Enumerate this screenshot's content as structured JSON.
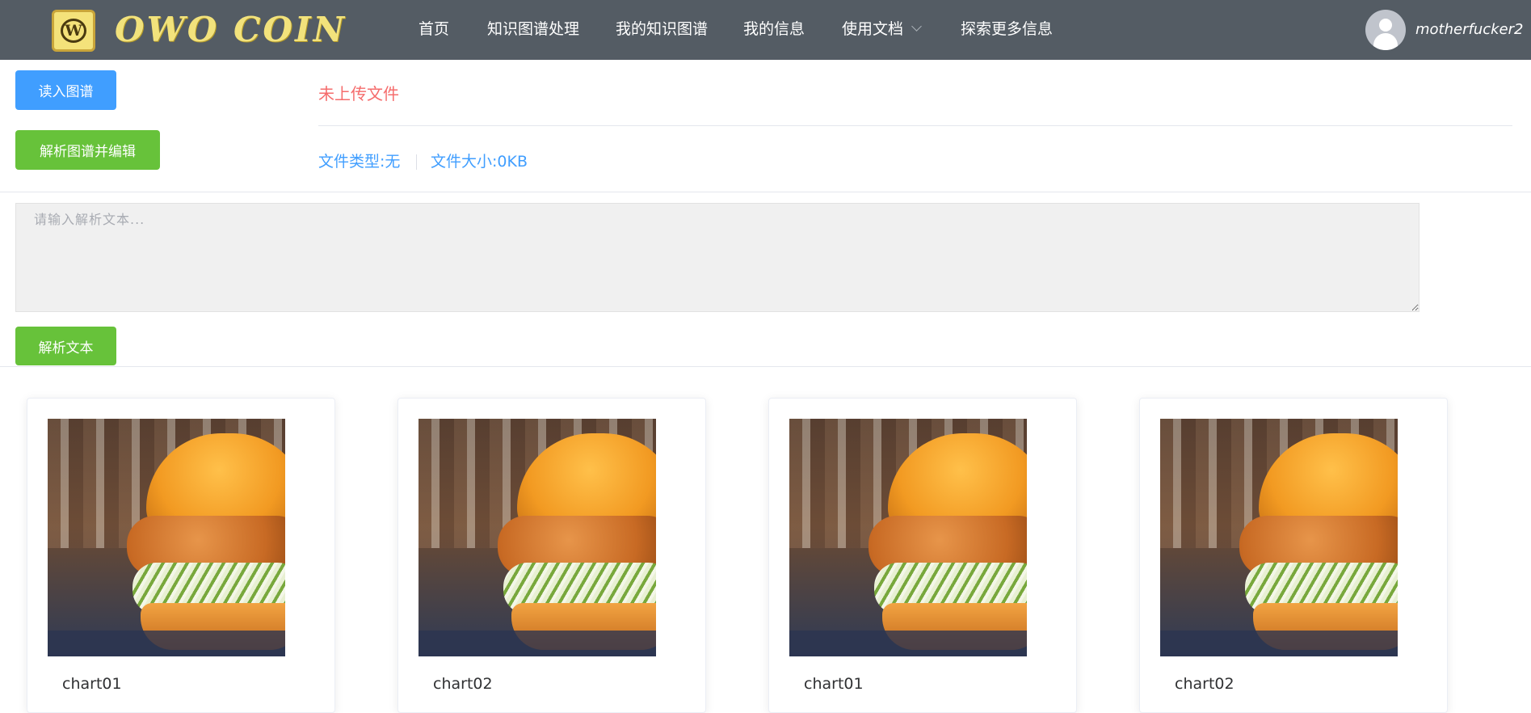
{
  "header": {
    "brand": "OWO COIN",
    "logo_letter": "W",
    "nav": [
      {
        "label": "首页"
      },
      {
        "label": "知识图谱处理"
      },
      {
        "label": "我的知识图谱"
      },
      {
        "label": "我的信息"
      },
      {
        "label": "使用文档",
        "has_dropdown": true
      },
      {
        "label": "探索更多信息"
      }
    ],
    "username": "motherfucker2"
  },
  "upload": {
    "read_button": "读入图谱",
    "parse_edit_button": "解析图谱并编辑",
    "status": "未上传文件",
    "file_type": "文件类型:无",
    "file_size": "文件大小:0KB"
  },
  "parse": {
    "placeholder": "请输入解析文本...",
    "value": "",
    "button": "解析文本"
  },
  "charts": [
    {
      "title": "chart01"
    },
    {
      "title": "chart02"
    },
    {
      "title": "chart01"
    },
    {
      "title": "chart02"
    }
  ],
  "colors": {
    "header_bg": "#545c64",
    "primary": "#409eff",
    "success": "#67c23a",
    "danger": "#f56c6c"
  }
}
